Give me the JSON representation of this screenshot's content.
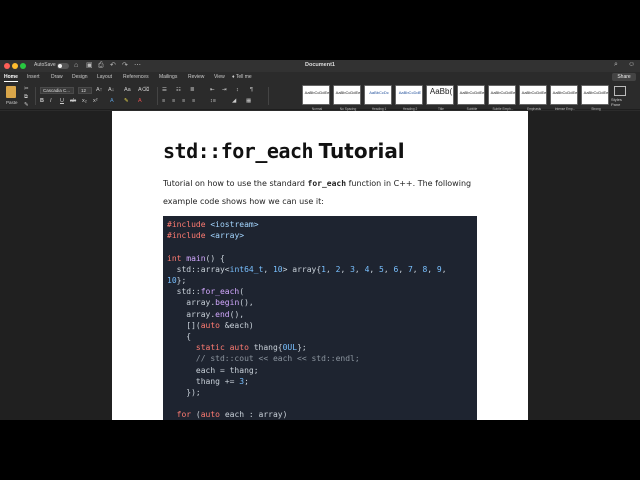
{
  "window": {
    "title": "Document1",
    "autosave_label": "AutoSave",
    "autosave_state": "off"
  },
  "ribbon_tabs": [
    "Home",
    "Insert",
    "Draw",
    "Design",
    "Layout",
    "References",
    "Mailings",
    "Review",
    "View",
    "Tell me"
  ],
  "share_label": "Share",
  "toolbar": {
    "paste_label": "Paste",
    "font_name": "Cascadia C...",
    "font_size": "12"
  },
  "styles": [
    {
      "sample": "AaBbCcDdEe",
      "label": "Normal"
    },
    {
      "sample": "AaBbCcDdEe",
      "label": "No Spacing"
    },
    {
      "sample": "AaBbCcDc",
      "label": "Heading 1"
    },
    {
      "sample": "AaBbCcDdE",
      "label": "Heading 2"
    },
    {
      "sample": "AaBb(",
      "label": "Title"
    },
    {
      "sample": "AaBbCcDdEe",
      "label": "Subtitle"
    },
    {
      "sample": "AaBbCcDdEe",
      "label": "Subtle Emph..."
    },
    {
      "sample": "AaBbCcDdEe",
      "label": "Emphasis"
    },
    {
      "sample": "AaBbCcDdEe",
      "label": "Intense Emp..."
    },
    {
      "sample": "AaBbCcDdEe",
      "label": "Strong"
    }
  ],
  "styles_pane_label": "Styles Pane",
  "document": {
    "heading_code": "std::for_each",
    "heading_word": "Tutorial",
    "para1_a": "Tutorial on how to use the standard ",
    "para1_code": "for_each",
    "para1_b": " function in C++. The following",
    "para2": "example code shows how we can use it:"
  },
  "code_lines": [
    [
      {
        "t": "#include ",
        "c": "kw"
      },
      {
        "t": "<iostream>",
        "c": "str"
      }
    ],
    [
      {
        "t": "#include ",
        "c": "kw"
      },
      {
        "t": "<array>",
        "c": "str"
      }
    ],
    [],
    [
      {
        "t": "int ",
        "c": "kw"
      },
      {
        "t": "main",
        "c": "fn"
      },
      {
        "t": "() {",
        "c": ""
      }
    ],
    [
      {
        "t": "  std::array<",
        "c": ""
      },
      {
        "t": "int64_t",
        "c": "ty"
      },
      {
        "t": ", ",
        "c": ""
      },
      {
        "t": "10",
        "c": "num"
      },
      {
        "t": "> array{",
        "c": ""
      },
      {
        "t": "1",
        "c": "num"
      },
      {
        "t": ", ",
        "c": ""
      },
      {
        "t": "2",
        "c": "num"
      },
      {
        "t": ", ",
        "c": ""
      },
      {
        "t": "3",
        "c": "num"
      },
      {
        "t": ", ",
        "c": ""
      },
      {
        "t": "4",
        "c": "num"
      },
      {
        "t": ", ",
        "c": ""
      },
      {
        "t": "5",
        "c": "num"
      },
      {
        "t": ", ",
        "c": ""
      },
      {
        "t": "6",
        "c": "num"
      },
      {
        "t": ", ",
        "c": ""
      },
      {
        "t": "7",
        "c": "num"
      },
      {
        "t": ", ",
        "c": ""
      },
      {
        "t": "8",
        "c": "num"
      },
      {
        "t": ", ",
        "c": ""
      },
      {
        "t": "9",
        "c": "num"
      },
      {
        "t": ",",
        "c": ""
      }
    ],
    [
      {
        "t": "10",
        "c": "num"
      },
      {
        "t": "};",
        "c": ""
      }
    ],
    [
      {
        "t": "  std::",
        "c": ""
      },
      {
        "t": "for_each",
        "c": "fn"
      },
      {
        "t": "(",
        "c": ""
      }
    ],
    [
      {
        "t": "    array.",
        "c": ""
      },
      {
        "t": "begin",
        "c": "fn"
      },
      {
        "t": "(),",
        "c": ""
      }
    ],
    [
      {
        "t": "    array.",
        "c": ""
      },
      {
        "t": "end",
        "c": "fn"
      },
      {
        "t": "(),",
        "c": ""
      }
    ],
    [
      {
        "t": "    [](",
        "c": ""
      },
      {
        "t": "auto",
        "c": "kw"
      },
      {
        "t": " &each)",
        "c": ""
      }
    ],
    [
      {
        "t": "    {",
        "c": ""
      }
    ],
    [
      {
        "t": "      static auto ",
        "c": "kw"
      },
      {
        "t": "thang{",
        "c": ""
      },
      {
        "t": "0UL",
        "c": "num"
      },
      {
        "t": "};",
        "c": ""
      }
    ],
    [
      {
        "t": "      // std::cout << each << std::endl;",
        "c": "cm"
      }
    ],
    [
      {
        "t": "      each = thang;",
        "c": ""
      }
    ],
    [
      {
        "t": "      thang += ",
        "c": ""
      },
      {
        "t": "3",
        "c": "num"
      },
      {
        "t": ";",
        "c": ""
      }
    ],
    [
      {
        "t": "    });",
        "c": ""
      }
    ],
    [],
    [
      {
        "t": "  for ",
        "c": "kw"
      },
      {
        "t": "(",
        "c": ""
      },
      {
        "t": "auto",
        "c": "kw"
      },
      {
        "t": " each : array)",
        "c": ""
      }
    ]
  ],
  "colors": {
    "code_bg": "#1e2430",
    "keyword": "#ff7b72",
    "string": "#a5d6ff",
    "number": "#79c0ff",
    "function": "#d2a8ff",
    "comment": "#8b949e"
  }
}
